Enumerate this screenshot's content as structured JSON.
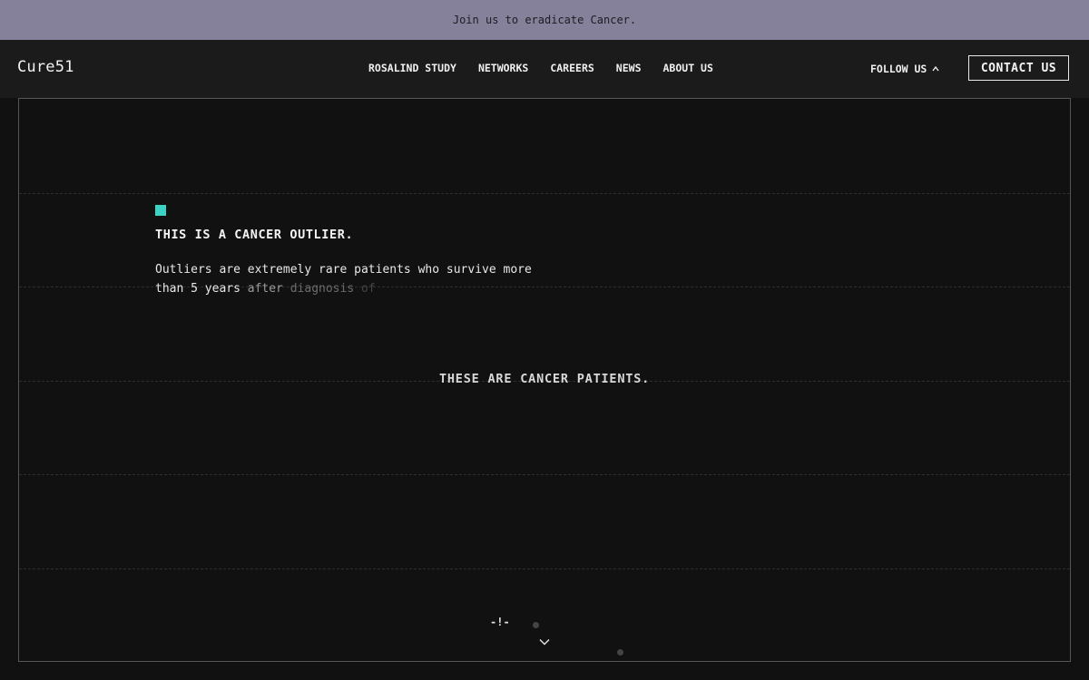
{
  "announcement": {
    "text": "Join us to eradicate Cancer."
  },
  "header": {
    "logo": "Cure51",
    "nav": [
      {
        "label": "ROSALIND STUDY"
      },
      {
        "label": "NETWORKS"
      },
      {
        "label": "CAREERS"
      },
      {
        "label": "NEWS"
      },
      {
        "label": "ABOUT US"
      }
    ],
    "follow_label": "FOLLOW US",
    "follow_icon": "caret-up-icon",
    "contact_label": "CONTACT US"
  },
  "hero": {
    "marker_color": "#3bd3c3",
    "outlier_title": "THIS IS A CANCER OUTLIER.",
    "outlier_desc": {
      "part1": "Outliers are extremely rare patients who survive more than 5 years",
      "part2": "after",
      "part3": "diagnosis",
      "part4": "of"
    },
    "patients_title": "THESE ARE CANCER PATIENTS.",
    "scroll_hint": "-!-",
    "scroll_icon": "chevron-down-icon"
  },
  "colors": {
    "announcement_bg": "#85819a",
    "page_bg": "#111111",
    "nav_bg": "#1b1b1b",
    "accent": "#3bd3c3"
  }
}
